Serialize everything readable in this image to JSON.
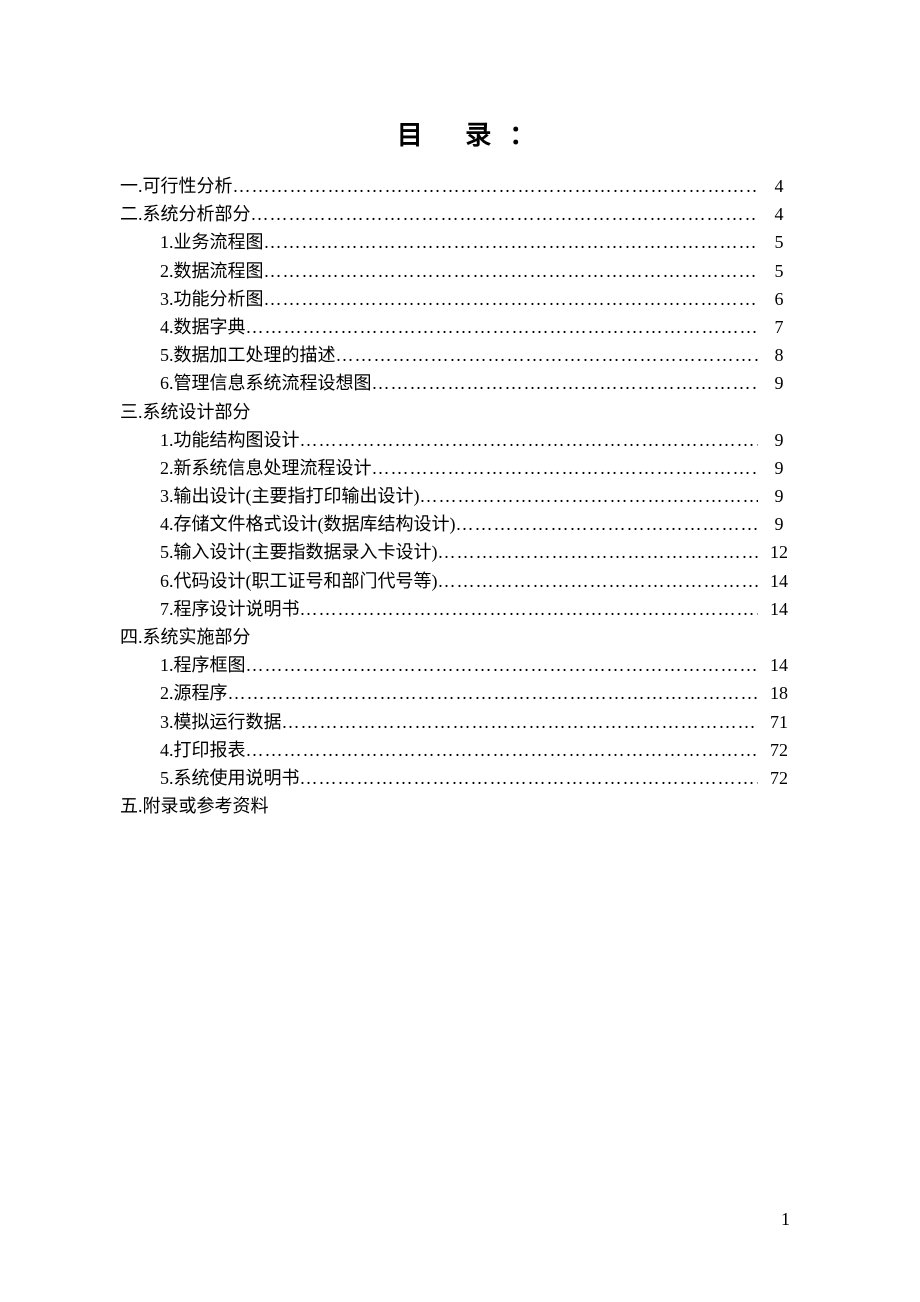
{
  "title": "目 录：",
  "pageNumber": "1",
  "toc": [
    {
      "level": 0,
      "label": "一.可行性分析",
      "page": "4",
      "dots": true
    },
    {
      "level": 0,
      "label": "二.系统分析部分",
      "page": "4",
      "dots": true
    },
    {
      "level": 1,
      "label": "1.业务流程图",
      "page": "5",
      "dots": true
    },
    {
      "level": 1,
      "label": "2.数据流程图",
      "page": "5",
      "dots": true
    },
    {
      "level": 1,
      "label": "3.功能分析图",
      "page": "6",
      "dots": true
    },
    {
      "level": 1,
      "label": "4.数据字典",
      "page": "7",
      "dots": true
    },
    {
      "level": 1,
      "label": "5.数据加工处理的描述",
      "page": "8",
      "dots": true
    },
    {
      "level": 1,
      "label": "6.管理信息系统流程设想图",
      "page": "9",
      "dots": true
    },
    {
      "level": 0,
      "label": "三.系统设计部分",
      "page": "",
      "dots": false
    },
    {
      "level": 1,
      "label": "1.功能结构图设计",
      "page": "9",
      "dots": true
    },
    {
      "level": 1,
      "label": "2.新系统信息处理流程设计",
      "page": "9",
      "dots": true
    },
    {
      "level": 1,
      "label": "3.输出设计(主要指打印输出设计)",
      "page": "9",
      "dots": true
    },
    {
      "level": 1,
      "label": "4.存储文件格式设计(数据库结构设计)",
      "page": "9",
      "dots": true
    },
    {
      "level": 1,
      "label": "5.输入设计(主要指数据录入卡设计)",
      "page": "12",
      "dots": true
    },
    {
      "level": 1,
      "label": "6.代码设计(职工证号和部门代号等)",
      "page": "14",
      "dots": true
    },
    {
      "level": 1,
      "label": "7.程序设计说明书",
      "page": "14",
      "dots": true
    },
    {
      "level": 0,
      "label": "四.系统实施部分",
      "page": "",
      "dots": false
    },
    {
      "level": 1,
      "label": "1.程序框图",
      "page": "14",
      "dots": true
    },
    {
      "level": 1,
      "label": "2.源程序",
      "page": "18",
      "dots": true
    },
    {
      "level": 1,
      "label": "3.模拟运行数据",
      "page": "71",
      "dots": true
    },
    {
      "level": 1,
      "label": "4.打印报表",
      "page": "72",
      "dots": true
    },
    {
      "level": 1,
      "label": "5.系统使用说明书",
      "page": "72",
      "dots": true
    },
    {
      "level": 0,
      "label": "五.附录或参考资料",
      "page": "",
      "dots": false
    }
  ]
}
